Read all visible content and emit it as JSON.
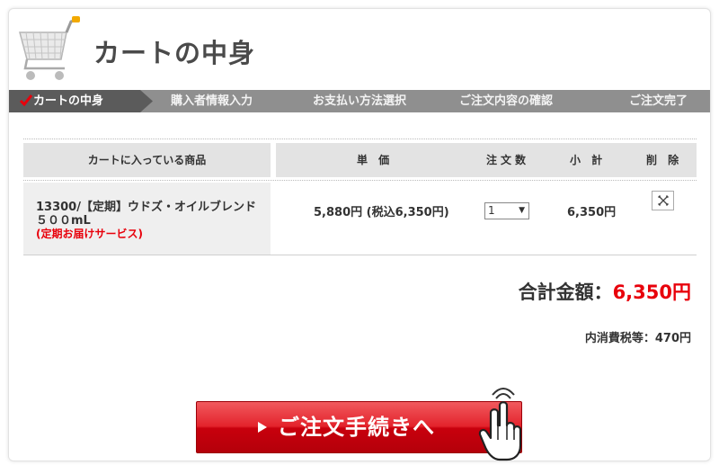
{
  "header": {
    "title": "カートの中身"
  },
  "steps": [
    {
      "label": "カートの中身",
      "active": true
    },
    {
      "label": "購入者情報入力"
    },
    {
      "label": "お支払い方法選択"
    },
    {
      "label": "ご注文内容の確認"
    },
    {
      "label": "ご注文完了"
    }
  ],
  "table": {
    "headers": {
      "product": "カートに入っている商品",
      "price": "単 価",
      "quantity": "注文数",
      "subtotal": "小 計",
      "delete": "削 除"
    },
    "rows": [
      {
        "name": "13300/【定期】ウドズ・オイルブレンド　５００mL",
        "note": "(定期お届けサービス)",
        "price": "5,880円 (税込6,350円)",
        "quantity": "1",
        "subtotal": "6,350円"
      }
    ]
  },
  "totals": {
    "label": "合計金額：",
    "amount": "6,350円",
    "tax_line": "内消費税等：470円"
  },
  "order_button": {
    "label": "ご注文手続きへ"
  },
  "colors": {
    "accent_red": "#e8000b",
    "step_bar": "#8f8f8f",
    "step_active": "#5b5b5b"
  }
}
